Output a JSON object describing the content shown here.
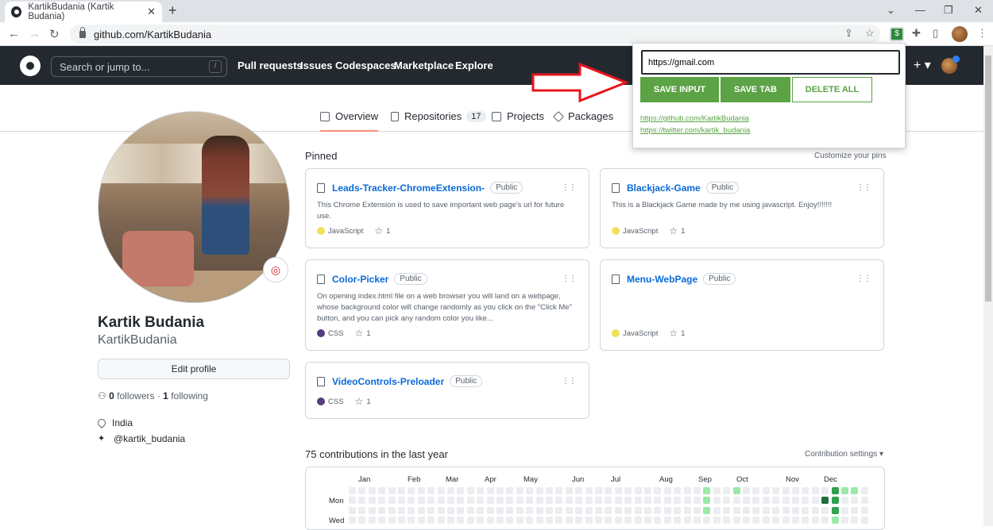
{
  "browser": {
    "tab_title": "KartikBudania (Kartik Budania)",
    "tab_close": "✕",
    "new_tab": "+",
    "url": "github.com/KartikBudania",
    "win_min": "⌄",
    "win_minimize": "—",
    "win_restore": "❐",
    "win_close": "✕"
  },
  "header": {
    "search_placeholder": "Search or jump to...",
    "search_key": "/",
    "nav": [
      "Pull requests",
      "Issues",
      "Codespaces",
      "Marketplace",
      "Explore"
    ],
    "plus": "+ ▾"
  },
  "profile_tabs": {
    "overview": "Overview",
    "repositories": "Repositories",
    "repositories_count": "17",
    "projects": "Projects",
    "packages": "Packages"
  },
  "profile": {
    "name": "Kartik Budania",
    "login": "KartikBudania",
    "edit_button": "Edit profile",
    "followers_count": "0",
    "followers_label": "followers",
    "following_count": "1",
    "following_label": "following",
    "location": "India",
    "twitter": "@kartik_budania"
  },
  "pinned": {
    "title": "Pinned",
    "customize": "Customize your pins",
    "repos": [
      {
        "name": "Leads-Tracker-ChromeExtension-",
        "visibility": "Public",
        "description": "This Chrome Extension is used to save important web page's url for future use.",
        "language": "JavaScript",
        "lang_color": "#f1e05a",
        "stars": "1"
      },
      {
        "name": "Blackjack-Game",
        "visibility": "Public",
        "description": "This is a Blackjack Game made by me using javascript. Enjoy!!!!!!!",
        "language": "JavaScript",
        "lang_color": "#f1e05a",
        "stars": "1"
      },
      {
        "name": "Color-Picker",
        "visibility": "Public",
        "description": "On opening index.html file on a web browser you will land on a webpage, whose background color will change randomly as you click on the \"Click Me\" button, and you can pick any random color you like...",
        "language": "CSS",
        "lang_color": "#563d7c",
        "stars": "1"
      },
      {
        "name": "Menu-WebPage",
        "visibility": "Public",
        "description": "",
        "language": "JavaScript",
        "lang_color": "#f1e05a",
        "stars": "1"
      },
      {
        "name": "VideoControls-Preloader",
        "visibility": "Public",
        "description": "",
        "language": "CSS",
        "lang_color": "#563d7c",
        "stars": "1"
      }
    ]
  },
  "contributions": {
    "title": "75 contributions in the last year",
    "settings": "Contribution settings ▾",
    "months": [
      "Jan",
      "Feb",
      "Mar",
      "Apr",
      "May",
      "Jun",
      "Jul",
      "Aug",
      "Sep",
      "Oct",
      "Nov",
      "Dec"
    ],
    "day_labels": [
      "Mon",
      "Wed"
    ]
  },
  "extension_popup": {
    "input_value": "https://gmail.com",
    "save_input": "SAVE INPUT",
    "save_tab": "SAVE TAB",
    "delete_all": "DELETE ALL",
    "links": [
      "https://github.com/KartikBudania",
      "https://twitter.com/kartik_budania"
    ],
    "accent": "#5ba345"
  },
  "annotation": {
    "arrow_color": "#e8141b"
  }
}
